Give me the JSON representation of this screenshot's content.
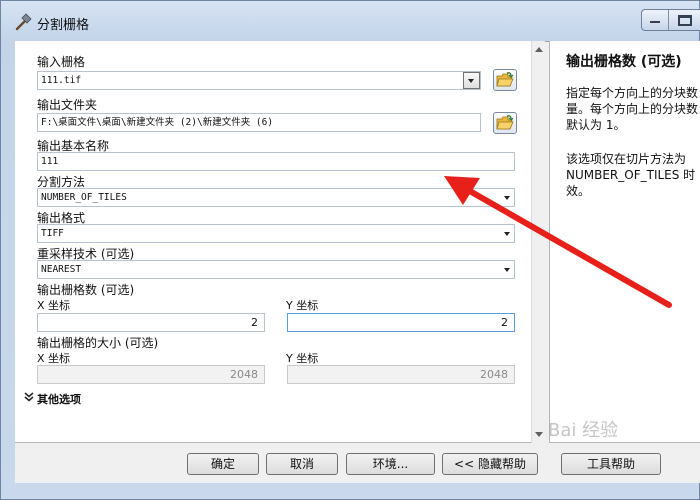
{
  "window": {
    "title": "分割栅格",
    "accent": "#c9d8ec"
  },
  "form": {
    "input_raster": {
      "label": "输入栅格",
      "value": "111.tif"
    },
    "output_folder": {
      "label": "输出文件夹",
      "value": "F:\\桌面文件\\桌面\\新建文件夹 (2)\\新建文件夹 (6)"
    },
    "base_name": {
      "label": "输出基本名称",
      "value": "111"
    },
    "split_method": {
      "label": "分割方法",
      "value": "NUMBER_OF_TILES"
    },
    "output_format": {
      "label": "输出格式",
      "value": "TIFF"
    },
    "resampling": {
      "label": "重采样技术 (可选)",
      "value": "NEAREST"
    },
    "num_rasters": {
      "label": "输出栅格数 (可选)",
      "x_label": "X 坐标",
      "x_value": "2",
      "y_label": "Y 坐标",
      "y_value": "2"
    },
    "tile_size": {
      "label": "输出栅格的大小 (可选)",
      "x_label": "X 坐标",
      "x_value": "2048",
      "y_label": "Y 坐标",
      "y_value": "2048"
    },
    "other_options": "其他选项"
  },
  "help": {
    "title": "输出栅格数 (可选)",
    "paragraph1": [
      "指定每个方向上的分块数",
      "量。每个方向上的分块数",
      "默认为 1。"
    ],
    "paragraph2": [
      "该选项仅在切片方法为",
      "NUMBER_OF_TILES 时",
      "效。"
    ]
  },
  "buttons": {
    "ok": "确定",
    "cancel": "取消",
    "environments": "环境...",
    "hide_help": "<< 隐藏帮助",
    "tool_help": "工具帮助"
  },
  "annotation": {
    "arrow_color": "#e8201a"
  },
  "watermark": "Bai 经验"
}
